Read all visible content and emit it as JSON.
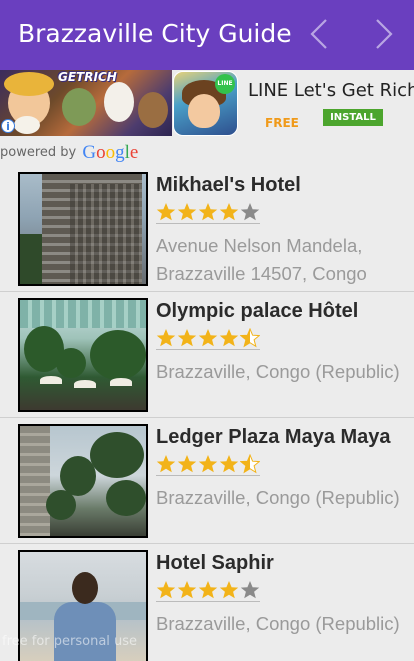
{
  "app_bar": {
    "title": "Brazzaville City Guide",
    "prev_icon": "chevron-left-icon",
    "next_icon": "chevron-right-icon",
    "color": "#6a3fbf"
  },
  "ad": {
    "banner_text": "GETRICH",
    "app_icon_badge": "LINE",
    "app_name": "LINE Let's Get Rich",
    "price_label": "FREE",
    "install_label": "INSTALL",
    "info_icon": "info-icon",
    "powered_by": "powered by",
    "provider": "Google"
  },
  "hotels": [
    {
      "name": "Mikhael's Hotel",
      "rating": 4.0,
      "address": "Avenue Nelson Mandela, Brazzaville 14507, Congo"
    },
    {
      "name": "Olympic palace Hôtel",
      "rating": 4.5,
      "address": "Brazzaville, Congo (Republic)"
    },
    {
      "name": "Ledger Plaza Maya Maya",
      "rating": 4.5,
      "address": "Brazzaville, Congo (Republic)"
    },
    {
      "name": "Hotel Saphir",
      "rating": 4.0,
      "address": "Brazzaville, Congo (Republic)"
    }
  ],
  "star_colors": {
    "filled": "#f2b319",
    "empty": "#8a8a8a"
  },
  "watermark": "free for personal use"
}
